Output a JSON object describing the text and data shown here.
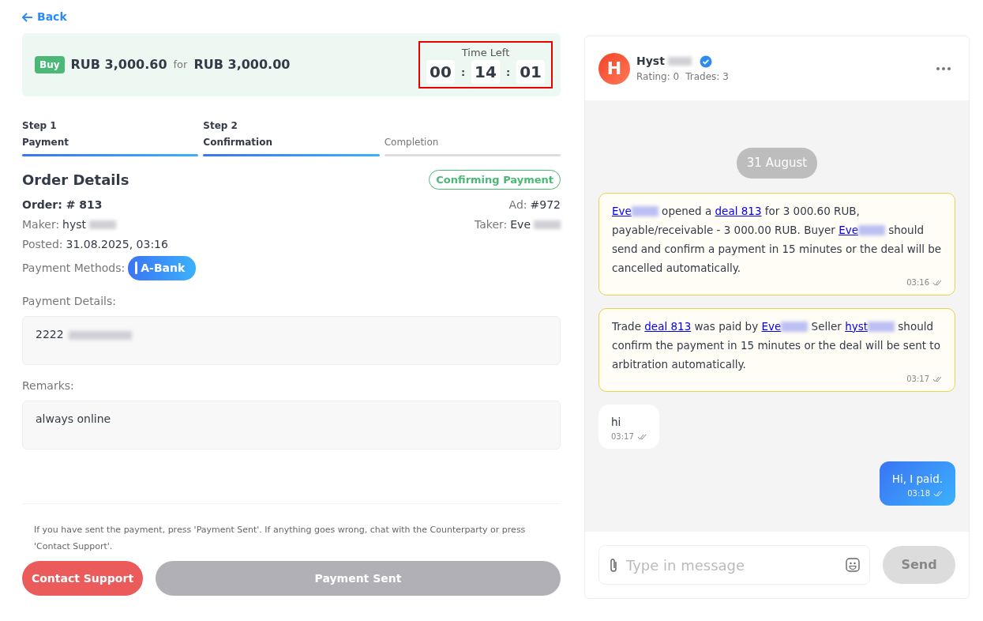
{
  "back": {
    "label": "Back"
  },
  "summary": {
    "side": "Buy",
    "amount": "RUB 3,000.60",
    "connector": "for",
    "price": "RUB 3,000.00",
    "timer": {
      "label": "Time Left",
      "parts": [
        "00",
        "14",
        "01"
      ],
      "separator": ":",
      "highlighted": true
    }
  },
  "steps": [
    {
      "step": "Step 1",
      "label": "Payment",
      "done": true
    },
    {
      "step": "Step 2",
      "label": "Confirmation",
      "done": true
    },
    {
      "label": "Completion",
      "done": false
    }
  ],
  "order": {
    "title": "Order Details",
    "status": "Confirming Payment",
    "order_no": "Order: # 813",
    "ad_label": "Ad:",
    "ad": "#972",
    "maker_label": "Maker:",
    "maker": "hyst",
    "maker_blurred": true,
    "taker_label": "Taker:",
    "taker": "Eve",
    "taker_blurred": true,
    "posted_label": "Posted:",
    "posted": "31.08.2025, 03:16",
    "methods_label": "Payment Methods:",
    "method": "A-Bank",
    "details_label": "Payment Details:",
    "details": "2222",
    "details_blurred": true,
    "remarks_label": "Remarks:",
    "remarks": "always online"
  },
  "notice": "If you have sent the payment, press 'Payment Sent'. If anything goes wrong, chat with the Counterparty or press 'Contact Support'.",
  "buttons": [
    {
      "label": "Contact Support",
      "kind": "danger",
      "disabled": false
    },
    {
      "label": "Payment Sent",
      "kind": "primary",
      "disabled": true
    }
  ],
  "chat": {
    "user": {
      "initial": "H",
      "name": "Hyst",
      "blurred": true,
      "verified": true,
      "rating": "Rating: 0",
      "trades": "Trades: 3"
    },
    "date": "31 August",
    "messages": [
      {
        "kind": "system",
        "time": "03:16",
        "segments": [
          {
            "kind": "link",
            "text": "Eve",
            "blurred": true
          },
          {
            "kind": "text",
            "text": " opened a "
          },
          {
            "kind": "link",
            "text": "deal 813"
          },
          {
            "kind": "text",
            "text": " for 3 000.60 RUB, payable/receivable - 3 000.00 RUB. Buyer "
          },
          {
            "kind": "link",
            "text": "Eve",
            "blurred": true
          },
          {
            "kind": "text",
            "text": " should send and confirm a payment in 15 minutes or the deal will be cancelled automatically."
          }
        ]
      },
      {
        "kind": "system",
        "time": "03:17",
        "segments": [
          {
            "kind": "text",
            "text": "Trade "
          },
          {
            "kind": "link",
            "text": "deal 813"
          },
          {
            "kind": "text",
            "text": " was paid by "
          },
          {
            "kind": "link",
            "text": "Eve",
            "blurred": true
          },
          {
            "kind": "text",
            "text": " Seller "
          },
          {
            "kind": "link",
            "text": "hyst",
            "blurred": true
          },
          {
            "kind": "text",
            "text": " should confirm the payment in 15 minutes or the deal will be sent to arbitration automatically."
          }
        ]
      },
      {
        "kind": "incoming",
        "time": "03:17",
        "segments": [
          {
            "kind": "text",
            "text": "hi"
          }
        ]
      },
      {
        "kind": "outgoing",
        "time": "03:18",
        "segments": [
          {
            "kind": "text",
            "text": "Hi, I paid."
          }
        ]
      }
    ],
    "input": {
      "placeholder": "Type in message"
    },
    "send": {
      "label": "Send",
      "disabled": true
    }
  }
}
